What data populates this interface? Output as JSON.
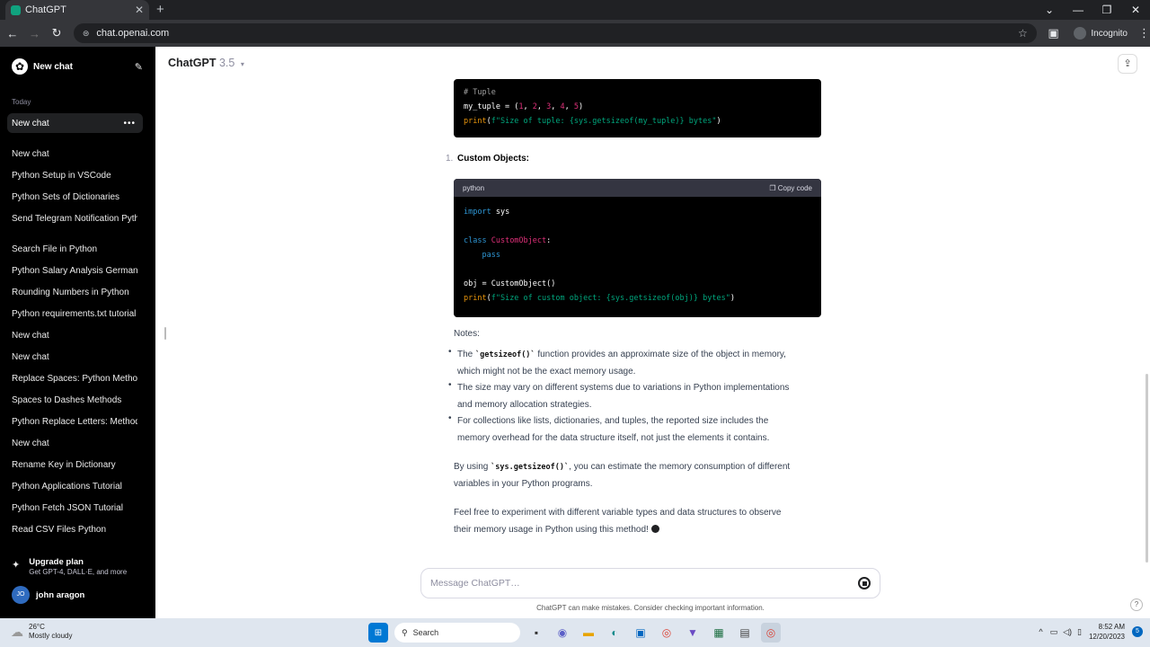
{
  "browser": {
    "tab_title": "ChatGPT",
    "url": "chat.openai.com",
    "profile": "Incognito"
  },
  "sidebar": {
    "new_chat": "New chat",
    "section_today": "Today",
    "active_item": "New chat",
    "items": [
      "New chat",
      "Python Setup in VSCode",
      "Python Sets of Dictionaries",
      "Send Telegram Notification Python",
      "Search File in Python",
      "Python Salary Analysis Germany",
      "Rounding Numbers in Python",
      "Python requirements.txt tutorial",
      "New chat",
      "New chat",
      "Replace Spaces: Python Methods",
      "Spaces to Dashes Methods",
      "Python Replace Letters: Methods",
      "New chat",
      "Rename Key in Dictionary",
      "Python Applications Tutorial",
      "Python Fetch JSON Tutorial",
      "Read CSV Files Python"
    ],
    "upgrade_title": "Upgrade plan",
    "upgrade_sub": "Get GPT-4, DALL·E, and more",
    "user_initials": "JO",
    "user_name": "john aragon"
  },
  "header": {
    "model": "ChatGPT",
    "version": "3.5"
  },
  "content": {
    "tuple_comment": "# Tuple",
    "custom_heading_num": "1.",
    "custom_heading": "Custom Objects:",
    "code_lang": "python",
    "copy_code": "Copy code",
    "notes_label": "Notes:",
    "bullet1_pre": "The ",
    "bullet1_code": "`getsizeof()`",
    "bullet1_post": " function provides an approximate size of the object in memory,",
    "bullet1_line2": "which might not be the exact memory usage.",
    "bullet2_line1": "The size may vary on different systems due to variations in Python implementations",
    "bullet2_line2": "and memory allocation strategies.",
    "bullet3_line1": "For collections like lists, dictionaries, and tuples, the reported size includes the",
    "bullet3_line2": "memory overhead for the data structure itself, not just the elements it contains.",
    "para1_pre": "By using ",
    "para1_code": "`sys.getsizeof()`",
    "para1_post": ", you can estimate the memory consumption of different",
    "para1_line2": "variables in your Python programs.",
    "para2_line1": "Feel free to experiment with different variable types and data structures to observe",
    "para2_line2": "their memory usage in Python using this method!"
  },
  "composer": {
    "placeholder": "Message ChatGPT…",
    "disclaimer": "ChatGPT can make mistakes. Consider checking important information.",
    "help": "?"
  },
  "taskbar": {
    "temp": "26°C",
    "weather": "Mostly cloudy",
    "search": "Search",
    "time": "8:52 AM",
    "date": "12/20/2023",
    "badge": "5"
  }
}
